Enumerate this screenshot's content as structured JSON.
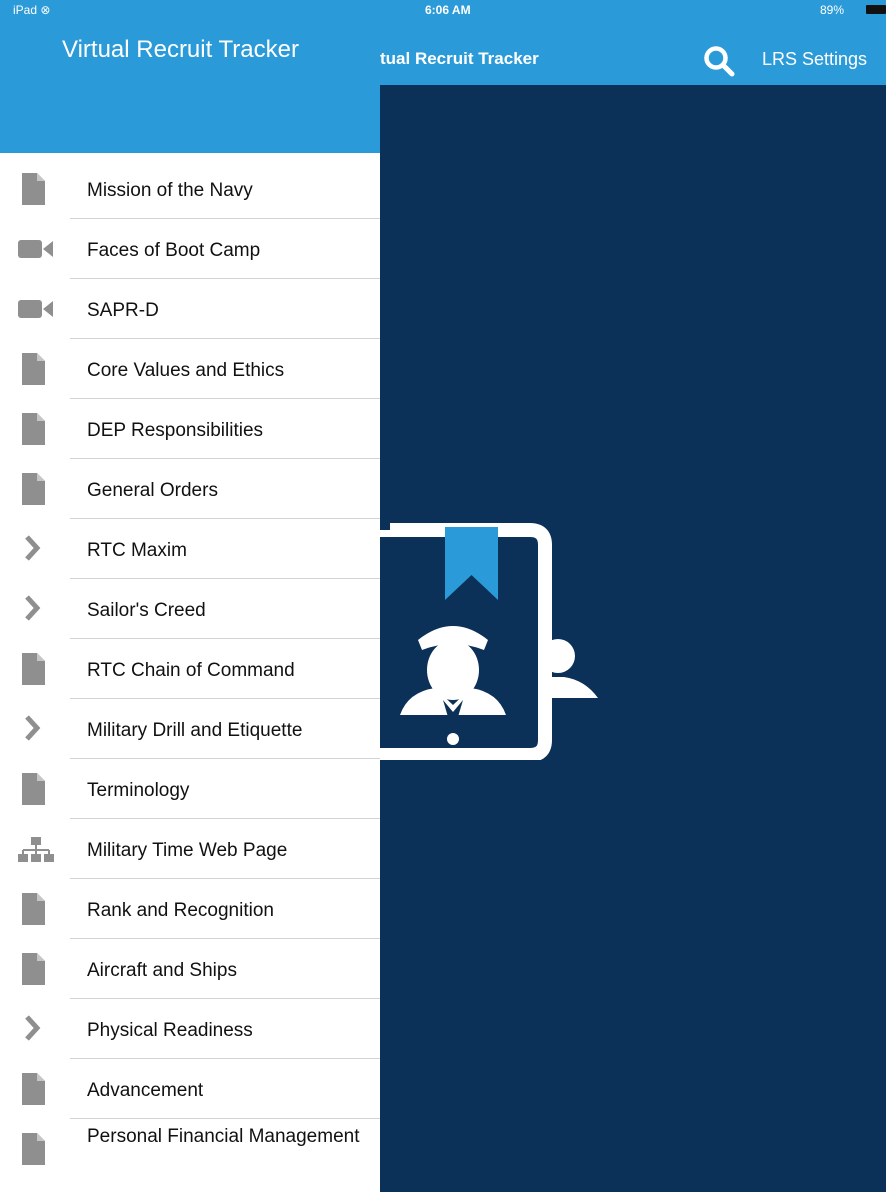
{
  "status_bar": {
    "device": "iPad ⊗",
    "time": "6:06 AM",
    "battery": "89%"
  },
  "main": {
    "title": "tual Recruit Tracker",
    "settings_label": "LRS Settings",
    "search_icon": "magnifier-icon"
  },
  "drawer": {
    "title": "Virtual Recruit Tracker",
    "items": [
      {
        "label": "Mission of the Navy",
        "icon": "document-icon"
      },
      {
        "label": "Faces of Boot Camp",
        "icon": "video-camera-icon"
      },
      {
        "label": "SAPR-D",
        "icon": "video-camera-icon"
      },
      {
        "label": "Core Values and Ethics",
        "icon": "document-icon"
      },
      {
        "label": "DEP Responsibilities",
        "icon": "document-icon"
      },
      {
        "label": "General Orders",
        "icon": "document-icon"
      },
      {
        "label": "RTC Maxim",
        "icon": "chevron-right-icon"
      },
      {
        "label": "Sailor's Creed",
        "icon": "chevron-right-icon"
      },
      {
        "label": "RTC Chain of Command",
        "icon": "document-icon"
      },
      {
        "label": "Military Drill and Etiquette",
        "icon": "chevron-right-icon"
      },
      {
        "label": "Terminology",
        "icon": "document-icon"
      },
      {
        "label": "Military Time Web Page",
        "icon": "sitemap-icon"
      },
      {
        "label": "Rank and Recognition",
        "icon": "document-icon"
      },
      {
        "label": "Aircraft and Ships",
        "icon": "document-icon"
      },
      {
        "label": "Physical Readiness",
        "icon": "chevron-right-icon"
      },
      {
        "label": "Advancement",
        "icon": "document-icon"
      },
      {
        "label": "Personal Financial Management",
        "icon": "document-icon"
      }
    ]
  },
  "colors": {
    "header_blue": "#2b9ad8",
    "background_navy": "#0b3158",
    "icon_gray": "#8f8f8f"
  }
}
